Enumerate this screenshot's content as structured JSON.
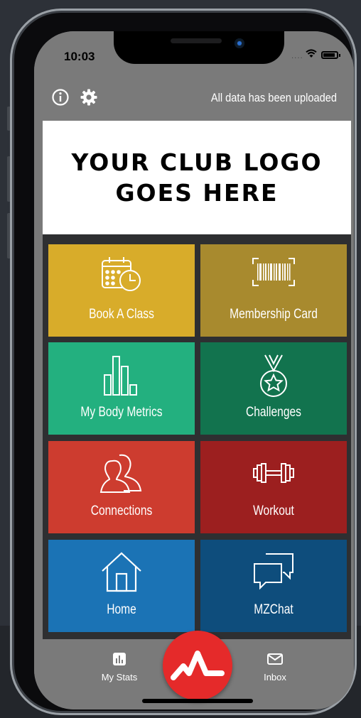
{
  "status_bar": {
    "time": "10:03"
  },
  "top_bar": {
    "info_icon": "info-icon",
    "settings_icon": "gear-icon",
    "upload_status": "All data has been uploaded"
  },
  "logo": {
    "line1": "YOUR CLUB LOGO",
    "line2": "GOES HERE"
  },
  "tiles": [
    {
      "label": "Book A Class",
      "icon": "calendar-clock-icon",
      "color": "#d8ac2a"
    },
    {
      "label": "Membership Card",
      "icon": "barcode-icon",
      "color": "#a88a2e"
    },
    {
      "label": "My Body Metrics",
      "icon": "bar-chart-icon",
      "color": "#23b07f"
    },
    {
      "label": "Challenges",
      "icon": "medal-icon",
      "color": "#12734e"
    },
    {
      "label": "Connections",
      "icon": "users-icon",
      "color": "#cd3c2f"
    },
    {
      "label": "Workout",
      "icon": "dumbbell-icon",
      "color": "#9c1f1f"
    },
    {
      "label": "Home",
      "icon": "home-icon",
      "color": "#1b73b5"
    },
    {
      "label": "MZChat",
      "icon": "chat-bubbles-icon",
      "color": "#0e4d7c"
    }
  ],
  "tab_bar": {
    "left": {
      "label": "My Stats",
      "icon": "stats-icon"
    },
    "center": {
      "icon": "heartbeat-logo-icon",
      "color": "#e52a2a"
    },
    "right": {
      "label": "Inbox",
      "icon": "mail-icon"
    }
  }
}
